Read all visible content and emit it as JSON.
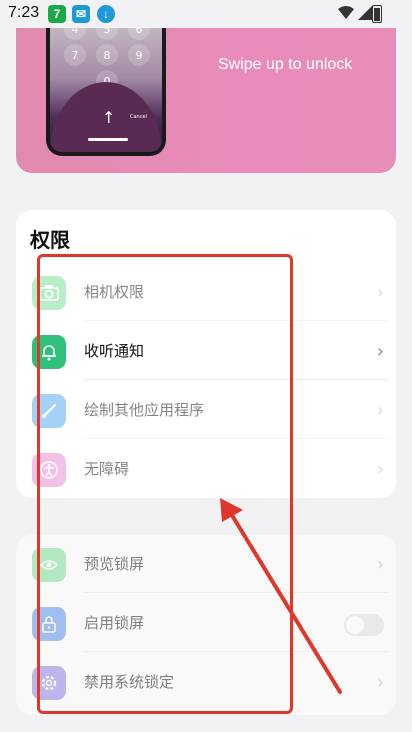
{
  "status_bar": {
    "time": "7:23",
    "app_icon_1": "7",
    "app_icon_2": "✉",
    "app_icon_3": "↓"
  },
  "banner": {
    "text": "Swipe up to unlock",
    "keypad": [
      "4",
      "5",
      "6",
      "7",
      "8",
      "9",
      "0"
    ],
    "cancel": "Cancel"
  },
  "permissions": {
    "title": "权限",
    "items": [
      {
        "label": "相机权限",
        "icon": "camera-icon",
        "color": "#6fd48a"
      },
      {
        "label": "收听通知",
        "icon": "bell-icon",
        "color": "#2fc07a"
      },
      {
        "label": "绘制其他应用程序",
        "icon": "brush-icon",
        "color": "#4fa8e8"
      },
      {
        "label": "无障碍",
        "icon": "accessibility-icon",
        "color": "#e58ad0"
      }
    ]
  },
  "lock": {
    "items": [
      {
        "label": "预览锁屏",
        "icon": "eye-icon",
        "color": "#6fd48a"
      },
      {
        "label": "启用锁屏",
        "icon": "lock-icon",
        "color": "#4f8fe8"
      },
      {
        "label": "禁用系统锁定",
        "icon": "gear-icon",
        "color": "#8a7fe0"
      }
    ]
  },
  "colors": {
    "annotation": "#e0372b",
    "background": "#f2f2f4"
  }
}
